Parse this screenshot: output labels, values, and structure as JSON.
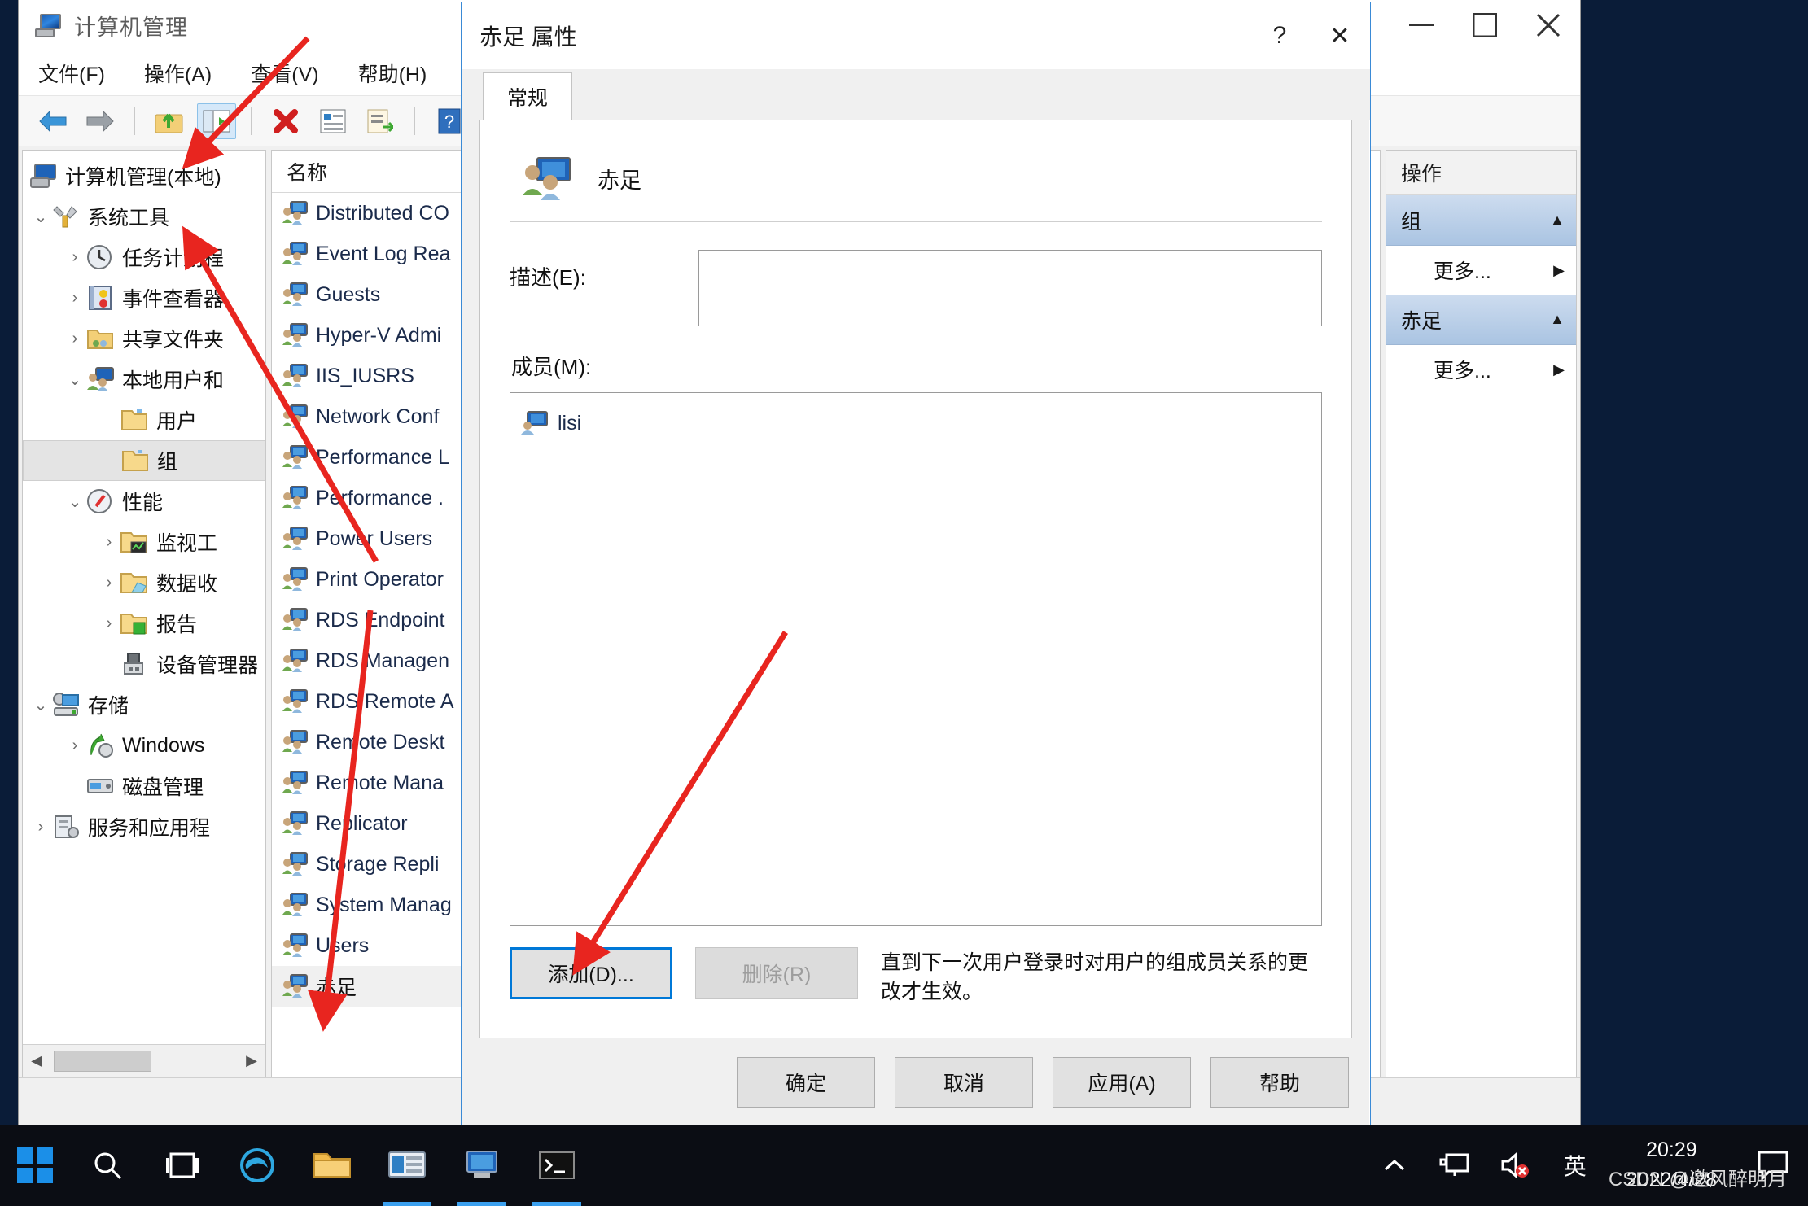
{
  "window": {
    "title": "计算机管理",
    "menus": [
      "文件(F)",
      "操作(A)",
      "查看(V)",
      "帮助(H)"
    ],
    "toolbar_icons": [
      "back-arrow",
      "forward-arrow",
      "up-folder",
      "show-tree",
      "delete",
      "properties",
      "export-list",
      "help",
      "show-console-tree"
    ]
  },
  "tree": {
    "root": "计算机管理(本地)",
    "items": [
      {
        "label": "系统工具",
        "indent": 1,
        "twisty": "down",
        "icon": "tools-icon"
      },
      {
        "label": "任务计划程",
        "indent": 2,
        "twisty": "right",
        "icon": "clock-icon"
      },
      {
        "label": "事件查看器",
        "indent": 2,
        "twisty": "right",
        "icon": "eventlog-icon"
      },
      {
        "label": "共享文件夹",
        "indent": 2,
        "twisty": "right",
        "icon": "shared-folder-icon"
      },
      {
        "label": "本地用户和",
        "indent": 2,
        "twisty": "down",
        "icon": "users-icon"
      },
      {
        "label": "用户",
        "indent": 3,
        "twisty": "",
        "icon": "folder-icon"
      },
      {
        "label": "组",
        "indent": 3,
        "twisty": "",
        "icon": "folder-icon",
        "selected": true
      },
      {
        "label": "性能",
        "indent": 2,
        "twisty": "down",
        "icon": "performance-icon"
      },
      {
        "label": "监视工",
        "indent": 3,
        "twisty": "right",
        "icon": "monitor-folder-icon"
      },
      {
        "label": "数据收",
        "indent": 3,
        "twisty": "right",
        "icon": "data-folder-icon"
      },
      {
        "label": "报告",
        "indent": 3,
        "twisty": "right",
        "icon": "report-folder-icon"
      },
      {
        "label": "设备管理器",
        "indent": 3,
        "twisty": "",
        "icon": "device-manager-icon"
      },
      {
        "label": "存储",
        "indent": 1,
        "twisty": "down",
        "icon": "storage-icon"
      },
      {
        "label": "Windows",
        "indent": 2,
        "twisty": "right",
        "icon": "windows-backup-icon"
      },
      {
        "label": "磁盘管理",
        "indent": 2,
        "twisty": "",
        "icon": "disk-icon"
      },
      {
        "label": "服务和应用程",
        "indent": 1,
        "twisty": "right",
        "icon": "services-icon"
      }
    ]
  },
  "list": {
    "column_header": "名称",
    "items": [
      {
        "label": "Distributed CO"
      },
      {
        "label": "Event Log Rea"
      },
      {
        "label": "Guests"
      },
      {
        "label": "Hyper-V Admi"
      },
      {
        "label": "IIS_IUSRS"
      },
      {
        "label": "Network Conf"
      },
      {
        "label": "Performance L"
      },
      {
        "label": "Performance ."
      },
      {
        "label": "Power Users"
      },
      {
        "label": "Print Operator"
      },
      {
        "label": "RDS Endpoint"
      },
      {
        "label": "RDS Managen"
      },
      {
        "label": "RDS Remote A"
      },
      {
        "label": "Remote Deskt"
      },
      {
        "label": "Remote Mana"
      },
      {
        "label": "Replicator"
      },
      {
        "label": "Storage Repli"
      },
      {
        "label": "System Manag"
      },
      {
        "label": "Users"
      },
      {
        "label": "赤足",
        "selected": true
      }
    ]
  },
  "actions": {
    "header": "操作",
    "groups": [
      {
        "title": "组",
        "items": [
          "更多..."
        ]
      },
      {
        "title": "赤足",
        "items": [
          "更多..."
        ]
      }
    ]
  },
  "dialog": {
    "title": "赤足 属性",
    "help_glyph": "?",
    "close_glyph": "✕",
    "tabs": [
      "常规"
    ],
    "group_name": "赤足",
    "description_label": "描述(E):",
    "description_value": "",
    "members_label": "成员(M):",
    "members": [
      {
        "name": "lisi"
      }
    ],
    "add_button": "添加(D)...",
    "remove_button": "删除(R)",
    "note": "直到下一次用户登录时对用户的组成员关系的更改才生效。",
    "footer_buttons": [
      "确定",
      "取消",
      "应用(A)",
      "帮助"
    ]
  },
  "taskbar": {
    "apps": [
      "search-icon",
      "task-view-icon",
      "edge-icon",
      "file-explorer-icon",
      "computer-management-icon",
      "remote-desktop-icon",
      "terminal-icon"
    ],
    "tray": {
      "chevron": "^",
      "network_icon": "network-icon",
      "volume_icon": "volume-muted-icon",
      "ime": "英"
    },
    "time": "20:29",
    "date": "2022/4/28",
    "action_center": "action-center-icon"
  },
  "watermark": "CSDN @邀风醉明月",
  "colors": {
    "accent": "#0078d7",
    "annotation": "#e8251f",
    "selection": "#aac4e2",
    "title_text": "#5b5b5b"
  }
}
